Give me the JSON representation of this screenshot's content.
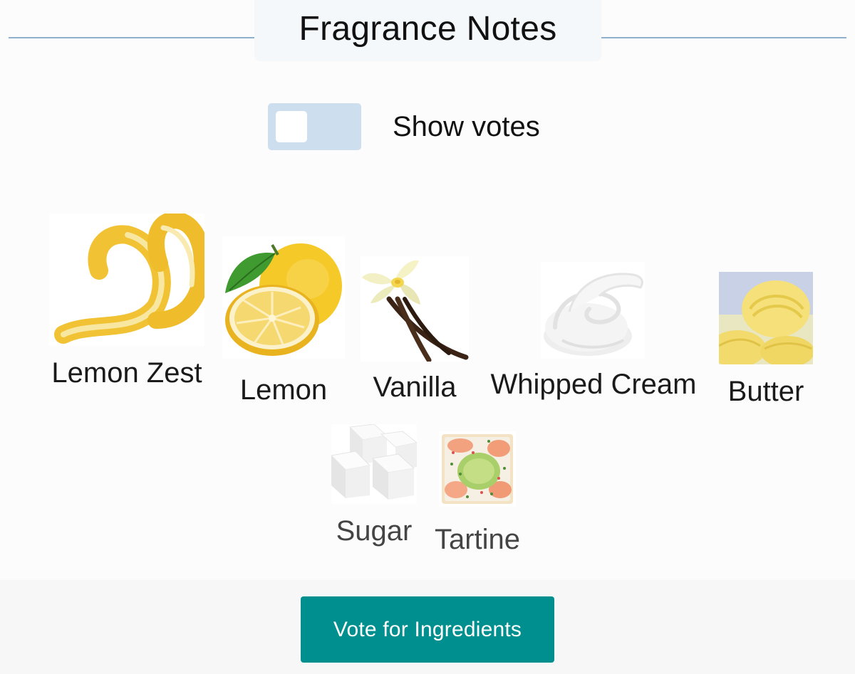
{
  "header": {
    "title": "Fragrance Notes"
  },
  "toggle": {
    "label": "Show votes",
    "checked": false
  },
  "notes": [
    {
      "label": "Lemon Zest",
      "icon": "lemon-zest-image"
    },
    {
      "label": "Lemon",
      "icon": "lemon-image"
    },
    {
      "label": "Vanilla",
      "icon": "vanilla-image"
    },
    {
      "label": "Whipped Cream",
      "icon": "whipped-cream-image"
    },
    {
      "label": "Butter",
      "icon": "butter-image"
    },
    {
      "label": "Sugar",
      "icon": "sugar-image"
    },
    {
      "label": "Tartine",
      "icon": "tartine-image"
    }
  ],
  "vote_button": {
    "label": "Vote for Ingredients"
  },
  "colors": {
    "accent": "#008f8f",
    "toggle_track": "#cddfee",
    "header_rule": "#8fb0cc"
  }
}
